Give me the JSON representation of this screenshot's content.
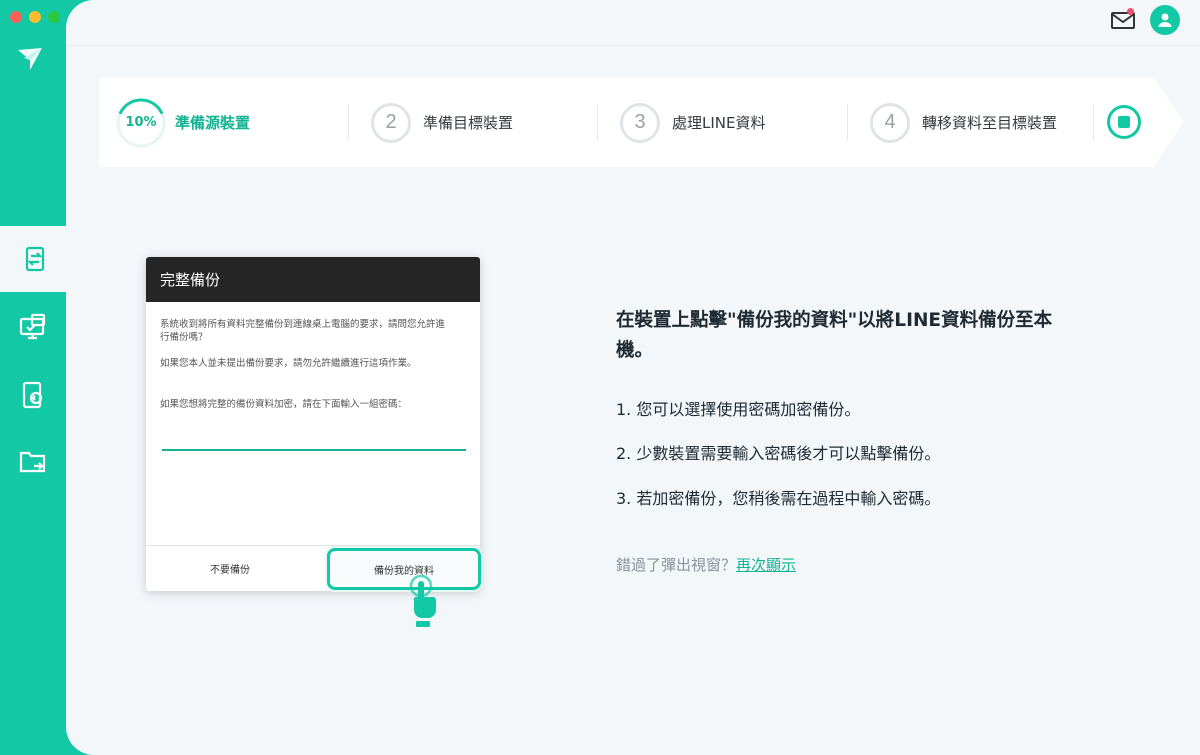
{
  "app": {
    "accent_color": "#13c8a4",
    "traffic_lights": [
      "close",
      "minimize",
      "zoom"
    ]
  },
  "sidebar": {
    "logo": "app-logo-icon",
    "items": [
      {
        "icon": "phone-transfer-icon",
        "active": true
      },
      {
        "icon": "computer-backup-icon",
        "active": false
      },
      {
        "icon": "restore-icon",
        "active": false
      },
      {
        "icon": "folder-export-icon",
        "active": false
      }
    ]
  },
  "topbar": {
    "mail_icon": "mail-icon",
    "mail_has_notification": true,
    "avatar_icon": "user-icon"
  },
  "steps": [
    {
      "marker": "10%",
      "label": "準備源裝置",
      "active": true,
      "progress_fraction": 0.1
    },
    {
      "marker": "2",
      "label": "準備目標裝置",
      "active": false
    },
    {
      "marker": "3",
      "label": "處理LINE資料",
      "active": false
    },
    {
      "marker": "4",
      "label": "轉移資料至目標裝置",
      "active": false
    }
  ],
  "stop_button_icon": "stop-icon",
  "dialog": {
    "title": "完整備份",
    "paragraph1": "系統收到將所有資料完整備份到連線桌上電腦的要求，請問您允許進行備份嗎？",
    "paragraph2": "如果您本人並未提出備份要求，請勿允許繼續進行這項作業。",
    "paragraph3": "如果您想將完整的備份資料加密，請在下面輸入一組密碼：",
    "button_no": "不要備份",
    "button_backup": "備份我的資料"
  },
  "instructions": {
    "title": "在裝置上點擊\"備份我的資料\"以將LINE資料備份至本機。",
    "items": [
      "1. 您可以選擇使用密碼加密備份。",
      "2. 少數裝置需要輸入密碼後才可以點擊備份。",
      "3. 若加密備份，您稍後需在過程中輸入密碼。"
    ],
    "missed_text": "錯過了彈出視窗？",
    "missed_link": "再次顯示"
  }
}
